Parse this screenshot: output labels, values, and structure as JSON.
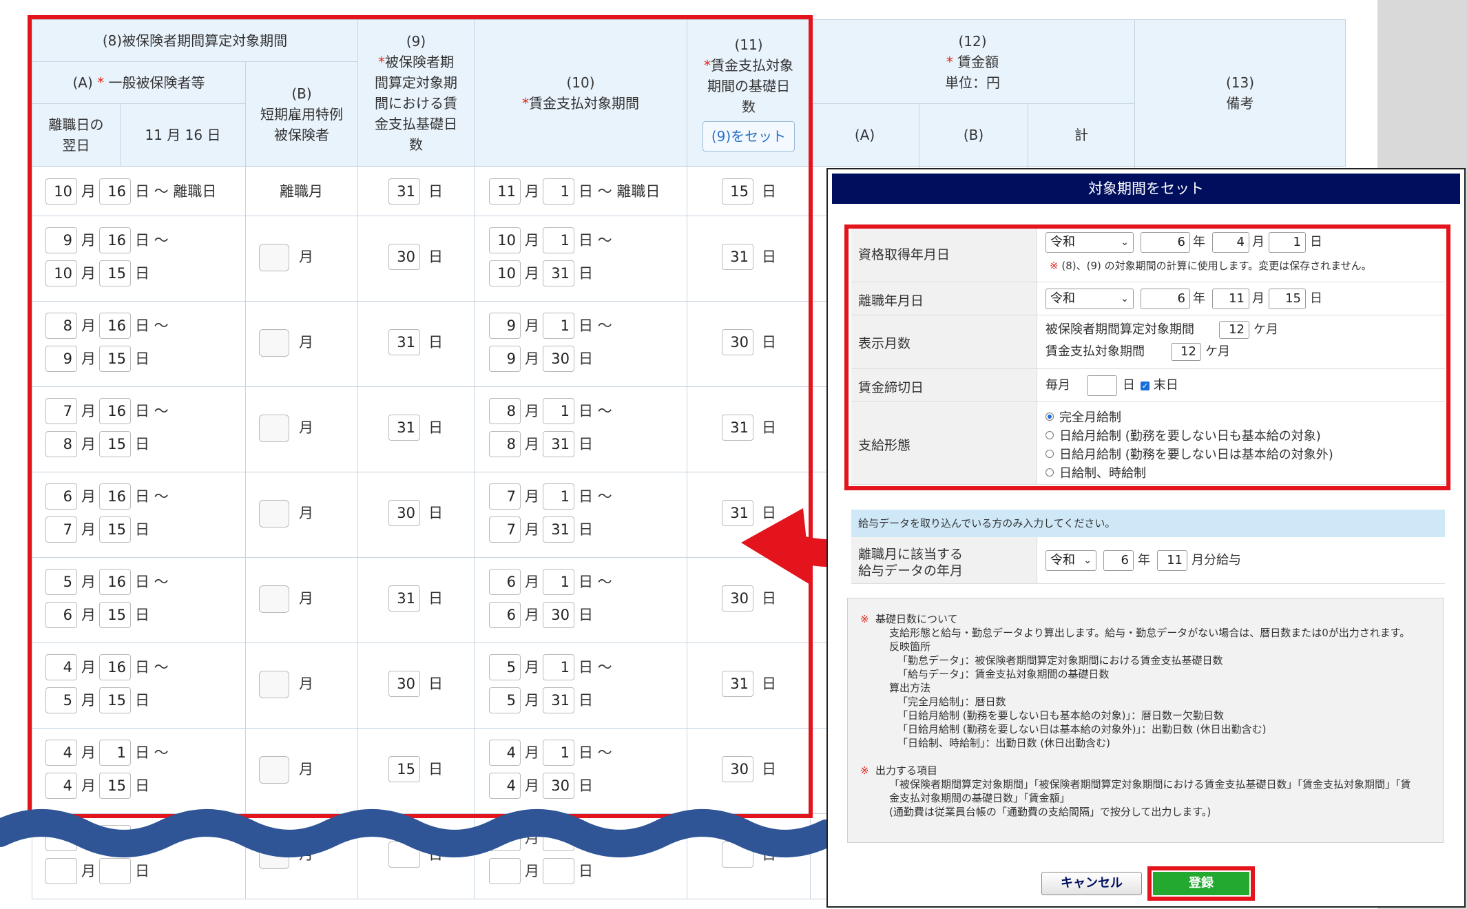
{
  "table": {
    "h8_title": "(8)被保険者期間算定対象期間",
    "h8a_prefix": "(A)",
    "h8a_star": "*",
    "h8a_label": "一般被保険者等",
    "h8a_sub_label": "離職日の\n翌日",
    "h8a_sub_value": "11 月 16 日",
    "h8b": "(B)\n短期雇用特例\n被保険者",
    "h9_num": "(9)",
    "h9_star": "*",
    "h9_label": "被保険者期\n間算定対象期\n間における賃\n金支払基礎日\n数",
    "h10_num": "(10)",
    "h10_star": "*",
    "h10_label": "賃金支払対象期間",
    "h11_num": "(11)",
    "h11_star": "*",
    "h11_label": "賃金支払対象\n期間の基礎日\n数",
    "h11_button": "(9)をセット",
    "h12_num": "(12)",
    "h12_star": "*",
    "h12_label": "賃金額\n単位：円",
    "h12_a": "(A)",
    "h12_b": "(B)",
    "h12_total": "計",
    "h13": "(13)\n備考",
    "u_month": "月",
    "u_day": "日",
    "u_tilde": "日 〜",
    "u_rishokubi": "日 〜 離職日",
    "rishoku_month": "離職月",
    "rows": [
      {
        "p_from_m": "10",
        "p_from_d": "16",
        "p_to_m": "",
        "p_to_d": "",
        "b": "",
        "days9": "31",
        "w_from_m": "11",
        "w_from_d": "1",
        "w_to_m": "",
        "w_to_d": "",
        "days11": "15"
      },
      {
        "p_from_m": "9",
        "p_from_d": "16",
        "p_to_m": "10",
        "p_to_d": "15",
        "b": "",
        "days9": "30",
        "w_from_m": "10",
        "w_from_d": "1",
        "w_to_m": "10",
        "w_to_d": "31",
        "days11": "31"
      },
      {
        "p_from_m": "8",
        "p_from_d": "16",
        "p_to_m": "9",
        "p_to_d": "15",
        "b": "",
        "days9": "31",
        "w_from_m": "9",
        "w_from_d": "1",
        "w_to_m": "9",
        "w_to_d": "30",
        "days11": "30"
      },
      {
        "p_from_m": "7",
        "p_from_d": "16",
        "p_to_m": "8",
        "p_to_d": "15",
        "b": "",
        "days9": "31",
        "w_from_m": "8",
        "w_from_d": "1",
        "w_to_m": "8",
        "w_to_d": "31",
        "days11": "31"
      },
      {
        "p_from_m": "6",
        "p_from_d": "16",
        "p_to_m": "7",
        "p_to_d": "15",
        "b": "",
        "days9": "30",
        "w_from_m": "7",
        "w_from_d": "1",
        "w_to_m": "7",
        "w_to_d": "31",
        "days11": "31"
      },
      {
        "p_from_m": "5",
        "p_from_d": "16",
        "p_to_m": "6",
        "p_to_d": "15",
        "b": "",
        "days9": "31",
        "w_from_m": "6",
        "w_from_d": "1",
        "w_to_m": "6",
        "w_to_d": "30",
        "days11": "30"
      },
      {
        "p_from_m": "4",
        "p_from_d": "16",
        "p_to_m": "5",
        "p_to_d": "15",
        "b": "",
        "days9": "30",
        "w_from_m": "5",
        "w_from_d": "1",
        "w_to_m": "5",
        "w_to_d": "31",
        "days11": "31"
      },
      {
        "p_from_m": "4",
        "p_from_d": "1",
        "p_to_m": "4",
        "p_to_d": "15",
        "b": "",
        "days9": "15",
        "w_from_m": "4",
        "w_from_d": "1",
        "w_to_m": "4",
        "w_to_d": "30",
        "days11": "30"
      }
    ]
  },
  "dialog": {
    "title": "対象期間をセット",
    "acq_label": "資格取得年月日",
    "acq_era": "令和",
    "acq_year": "6",
    "acq_month": "4",
    "acq_day": "1",
    "u_year": "年",
    "u_month": "月",
    "u_day": "日",
    "acq_note_mark": "※",
    "acq_note": "(8)、(9) の対象期間の計算に使用します。変更は保存されません。",
    "leave_label": "離職年月日",
    "leave_era": "令和",
    "leave_year": "6",
    "leave_month": "11",
    "leave_day": "15",
    "months_label": "表示月数",
    "months_1_label": "被保険者期間算定対象期間",
    "months_1": "12",
    "months_2_label": "賃金支払対象期間",
    "months_2": "12",
    "u_kagetsu": "ケ月",
    "cutoff_label": "賃金締切日",
    "cutoff_prefix": "毎月",
    "cutoff_day": "",
    "cutoff_end": "末日",
    "pay_label": "支給形態",
    "pay_options": [
      "完全月給制",
      "日給月給制 (勤務を要しない日も基本給の対象)",
      "日給月給制 (勤務を要しない日は基本給の対象外)",
      "日給制、時給制"
    ],
    "info_bar": "給与データを取り込んでいる方のみ入力してください。",
    "salary_label_1": "離職月に該当する",
    "salary_label_2": "給与データの年月",
    "salary_era": "令和",
    "salary_year": "6",
    "salary_month": "11",
    "salary_suffix": "月分給与",
    "info_mark": "※",
    "info_lines_1": [
      "基礎日数について",
      "支給形態と給与・勤怠データより算出します。給与・勤怠データがない場合は、暦日数または0が出力されます。",
      "反映箇所",
      "「勤怠データ」：被保険者期間算定対象期間における賃金支払基礎日数",
      "「給与データ」：賃金支払対象期間の基礎日数",
      "算出方法",
      "「完全月給制」：暦日数",
      "「日給月給制 (勤務を要しない日も基本給の対象)」：暦日数ー欠勤日数",
      "「日給月給制 (勤務を要しない日は基本給の対象外)」：出勤日数 (休日出勤含む)",
      "「日給制、時給制」：出勤日数 (休日出勤含む)"
    ],
    "info_lines_2": [
      "出力する項目",
      "「被保険者期間算定対象期間」「被保険者期間算定対象期間における賃金支払基礎日数」「賃金支払対象期間」「賃",
      "金支払対象期間の基礎日数」「賃金額」",
      "(通勤費は従業員台帳の「通勤費の支給間隔」で按分して出力します。)"
    ],
    "cancel_button": "キャンセル",
    "register_button": "登録"
  },
  "colors": {
    "highlight": "#e3141c",
    "dialog_title_bg": "#000e5e",
    "register_bg": "#23a830",
    "header_bg": "#e9f3fc",
    "wave": "#2f5597"
  }
}
